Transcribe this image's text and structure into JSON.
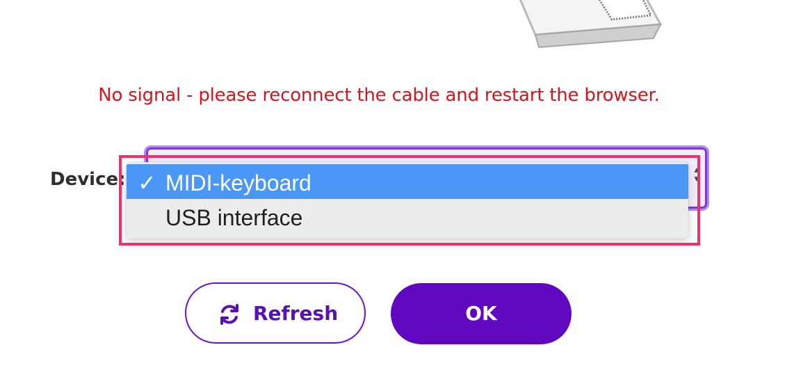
{
  "illustration": {
    "icon": "midi-device-illustration"
  },
  "error": {
    "message": "No signal - please reconnect the cable and restart the browser.",
    "color": "#d6141d"
  },
  "device_selector": {
    "label": "Device:",
    "options": [
      {
        "check": "✓",
        "label": "MIDI-keyboard",
        "selected": true
      },
      {
        "check": "",
        "label": "USB interface",
        "selected": false
      }
    ],
    "highlight_color": "#f0306a"
  },
  "buttons": {
    "refresh": {
      "label": "Refresh",
      "icon": "refresh-icon"
    },
    "ok": {
      "label": "OK"
    }
  },
  "colors": {
    "brand_purple": "#6007c0",
    "selection_blue": "#4a97f5"
  }
}
